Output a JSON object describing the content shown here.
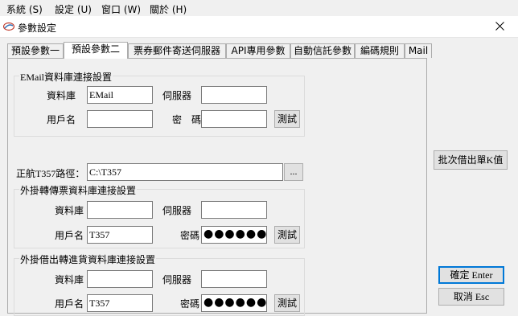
{
  "menubar": {
    "items": [
      "系統 (S)",
      "設定 (U)",
      "窗口 (W)",
      "關於 (H)"
    ]
  },
  "window": {
    "title": "參數設定"
  },
  "tabs": [
    {
      "label": "預設參數一"
    },
    {
      "label": "預設參數二"
    },
    {
      "label": "票券郵件寄送伺服器"
    },
    {
      "label": "API專用參數"
    },
    {
      "label": "自動信託參數"
    },
    {
      "label": "編碼規則"
    },
    {
      "label": "Mail"
    }
  ],
  "email_group": {
    "title": "EMail資料庫連接設置",
    "db_label": "資料庫",
    "db_value": "EMail",
    "server_label": "伺服器",
    "server_value": "",
    "user_label": "用戶名",
    "user_value": "",
    "pwd_label": "密　碼",
    "pwd_value": "",
    "test_label": "測試"
  },
  "path": {
    "label": "正航T357路徑：",
    "value": "C:\\T357",
    "browse_label": "..."
  },
  "plugin_transfer_group": {
    "title": "外掛轉傳票資料庫連接設置",
    "db_label": "資料庫",
    "db_value": "",
    "server_label": "伺服器",
    "server_value": "",
    "user_label": "用戶名",
    "user_value": "T357",
    "pwd_label": "密碼",
    "pwd_value": "●●●●●●●",
    "test_label": "測試"
  },
  "plugin_borrow_group": {
    "title": "外掛借出轉進貨資料庫連接設置",
    "db_label": "資料庫",
    "db_value": "",
    "server_label": "伺服器",
    "server_value": "",
    "user_label": "用戶名",
    "user_value": "T357",
    "pwd_label": "密碼",
    "pwd_value": "●●●●●●●",
    "test_label": "測試"
  },
  "side_buttons": {
    "batch_label": "批次借出單K值",
    "ok_label": "確定 Enter",
    "cancel_label": "取消 Esc"
  }
}
